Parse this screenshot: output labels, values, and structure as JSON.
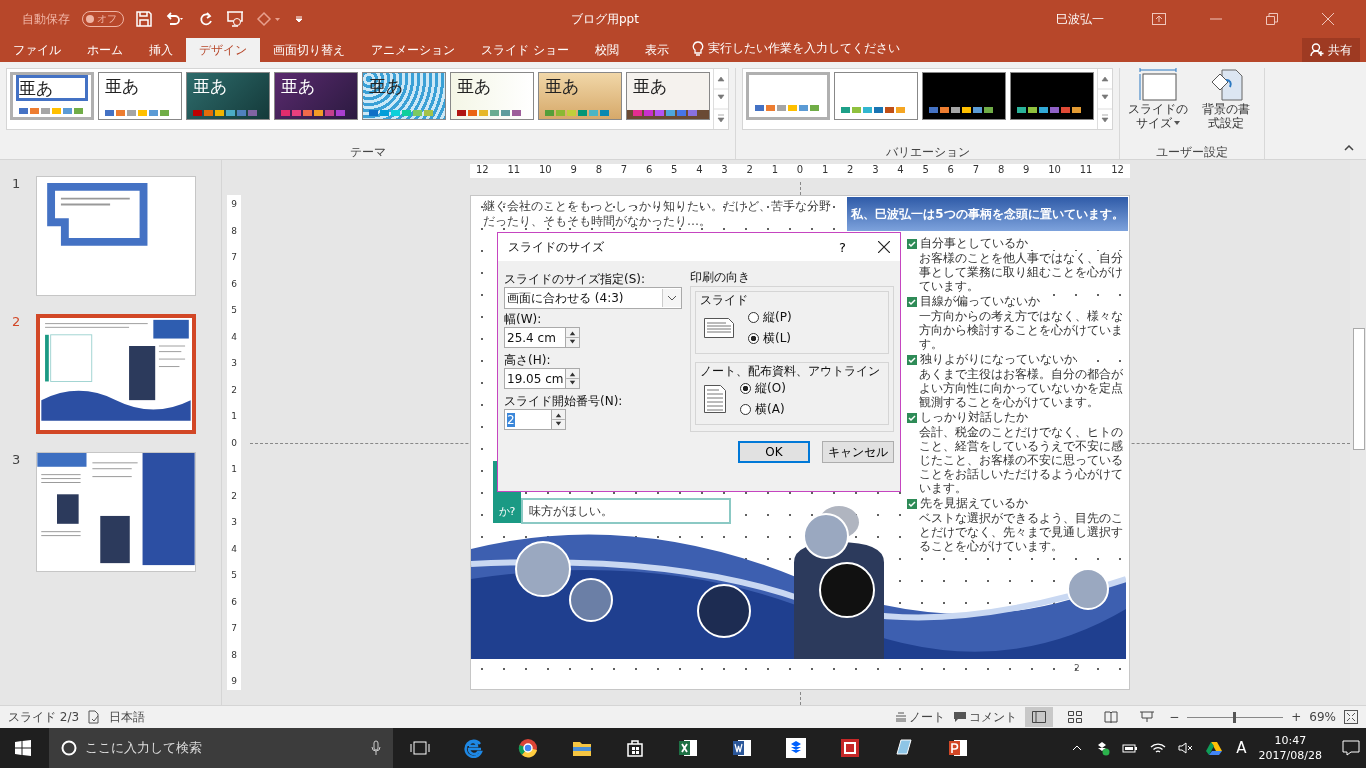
{
  "title_bar": {
    "autosave_label": "自動保存",
    "autosave_toggle": {
      "label": "オフ",
      "on": false
    },
    "title": "ブログ用ppt",
    "user": "巳波弘一"
  },
  "ribbon_tabs": [
    {
      "label": "ファイル",
      "selected": false
    },
    {
      "label": "ホーム",
      "selected": false
    },
    {
      "label": "挿入",
      "selected": false
    },
    {
      "label": "デザイン",
      "selected": true
    },
    {
      "label": "画面切り替え",
      "selected": false
    },
    {
      "label": "アニメーション",
      "selected": false
    },
    {
      "label": "スライド ショー",
      "selected": false
    },
    {
      "label": "校閲",
      "selected": false
    },
    {
      "label": "表示",
      "selected": false
    }
  ],
  "tell_me": "実行したい作業を入力してください",
  "share": "共有",
  "themes": {
    "label": "テーマ",
    "items": [
      {
        "sample": "亜あ",
        "kind": "office",
        "selected": true
      },
      {
        "sample": "亜あ",
        "kind": "plain",
        "selected": false
      },
      {
        "sample": "亜あ",
        "kind": "teal",
        "selected": false
      },
      {
        "sample": "亜あ",
        "kind": "purple",
        "selected": false
      },
      {
        "sample": "亜あ",
        "kind": "pattern",
        "selected": false
      },
      {
        "sample": "亜あ",
        "kind": "cream",
        "selected": false
      },
      {
        "sample": "亜あ",
        "kind": "wood",
        "selected": false
      },
      {
        "sample": "亜あ",
        "kind": "paper",
        "selected": false
      }
    ]
  },
  "variations": {
    "label": "バリエーション",
    "items": [
      {
        "kind": "light",
        "selected": true
      },
      {
        "kind": "light-green",
        "selected": false
      },
      {
        "kind": "dark",
        "selected": false
      },
      {
        "kind": "dark-green",
        "selected": false
      }
    ]
  },
  "customize": {
    "label": "ユーザー設定",
    "buttons": [
      {
        "lines": [
          "スライドの",
          "サイズ"
        ],
        "dropdown": true
      },
      {
        "lines": [
          "背景の書",
          "式設定"
        ],
        "dropdown": false
      }
    ]
  },
  "thumbnails": [
    {
      "number": "1",
      "selected": false,
      "kind": "box"
    },
    {
      "number": "2",
      "selected": true,
      "kind": "spread"
    },
    {
      "number": "3",
      "selected": false,
      "kind": "brochure"
    }
  ],
  "rulers": {
    "horizontal": [
      "12",
      "11",
      "10",
      "9",
      "8",
      "7",
      "6",
      "5",
      "4",
      "3",
      "2",
      "1",
      "0",
      "1",
      "2",
      "3",
      "4",
      "5",
      "6",
      "7",
      "8",
      "9",
      "10",
      "11",
      "12"
    ],
    "vertical": [
      "9",
      "8",
      "7",
      "6",
      "5",
      "4",
      "3",
      "2",
      "1",
      "0",
      "1",
      "2",
      "3",
      "4",
      "5",
      "6",
      "7",
      "8",
      "9"
    ]
  },
  "slide": {
    "intro": "継ぐ会社のことをもっとしっかり知りたい。だけど、苦手な分野だったり、そもそも時間がなかったり…。",
    "side_label": "か?",
    "wish": "味方がほしい。",
    "panel_title": "私、巳波弘一は5つの事柄を念頭に置いています。",
    "checklist": [
      {
        "heading": "自分事としているか",
        "text": "お客様のことを他人事ではなく、自分事として業務に取り組むことを心がけています。"
      },
      {
        "heading": "目線が偏っていないか",
        "text": "一方向からの考え方ではなく、様々な方向から検討することを心がけています。"
      },
      {
        "heading": "独りよがりになっていないか",
        "text": "あくまで主役はお客様。自分の都合がよい方向性に向かっていないかを定点観測することを心がけています。"
      },
      {
        "heading": "しっかり対話したか",
        "text": "会計、税金のことだけでなく、ヒトのこと、経営をしているうえで不安に感じたこと、お客様の不安に思っていることをお話しいただけるよう心がけています。"
      },
      {
        "heading": "先を見据えているか",
        "text": "ベストな選択ができるよう、目先のことだけでなく、先々まで見通し選択することを心がけています。"
      }
    ],
    "page_number": "2"
  },
  "dialog": {
    "title": "スライドのサイズ",
    "help": "?",
    "size_label": "スライドのサイズ指定(S):",
    "size_value": "画面に合わせる (4:3)",
    "width_label": "幅(W):",
    "width_value": "25.4 cm",
    "height_label": "高さ(H):",
    "height_value": "19.05 cm",
    "start_label": "スライド開始番号(N):",
    "start_value": "2",
    "orientation_label": "印刷の向き",
    "groups": [
      {
        "label": "スライド",
        "kind": "landscape",
        "options": [
          {
            "label": "縦(P)",
            "selected": false
          },
          {
            "label": "横(L)",
            "selected": true
          }
        ]
      },
      {
        "label": "ノート、配布資料、アウトライン",
        "kind": "portrait",
        "options": [
          {
            "label": "縦(O)",
            "selected": true
          },
          {
            "label": "横(A)",
            "selected": false
          }
        ]
      }
    ],
    "ok": "OK",
    "cancel": "キャンセル"
  },
  "status_bar": {
    "slide": "スライド 2/3",
    "language": "日本語",
    "notes": "ノート",
    "comments": "コメント",
    "zoom_out": "−",
    "zoom": {
      "level": 0.48
    },
    "zoom_in": "+",
    "zoom_text": "69%"
  },
  "taskbar": {
    "search_placeholder": "ここに入力して検索",
    "ime": "A",
    "time": "10:47",
    "date": "2017/08/28"
  }
}
